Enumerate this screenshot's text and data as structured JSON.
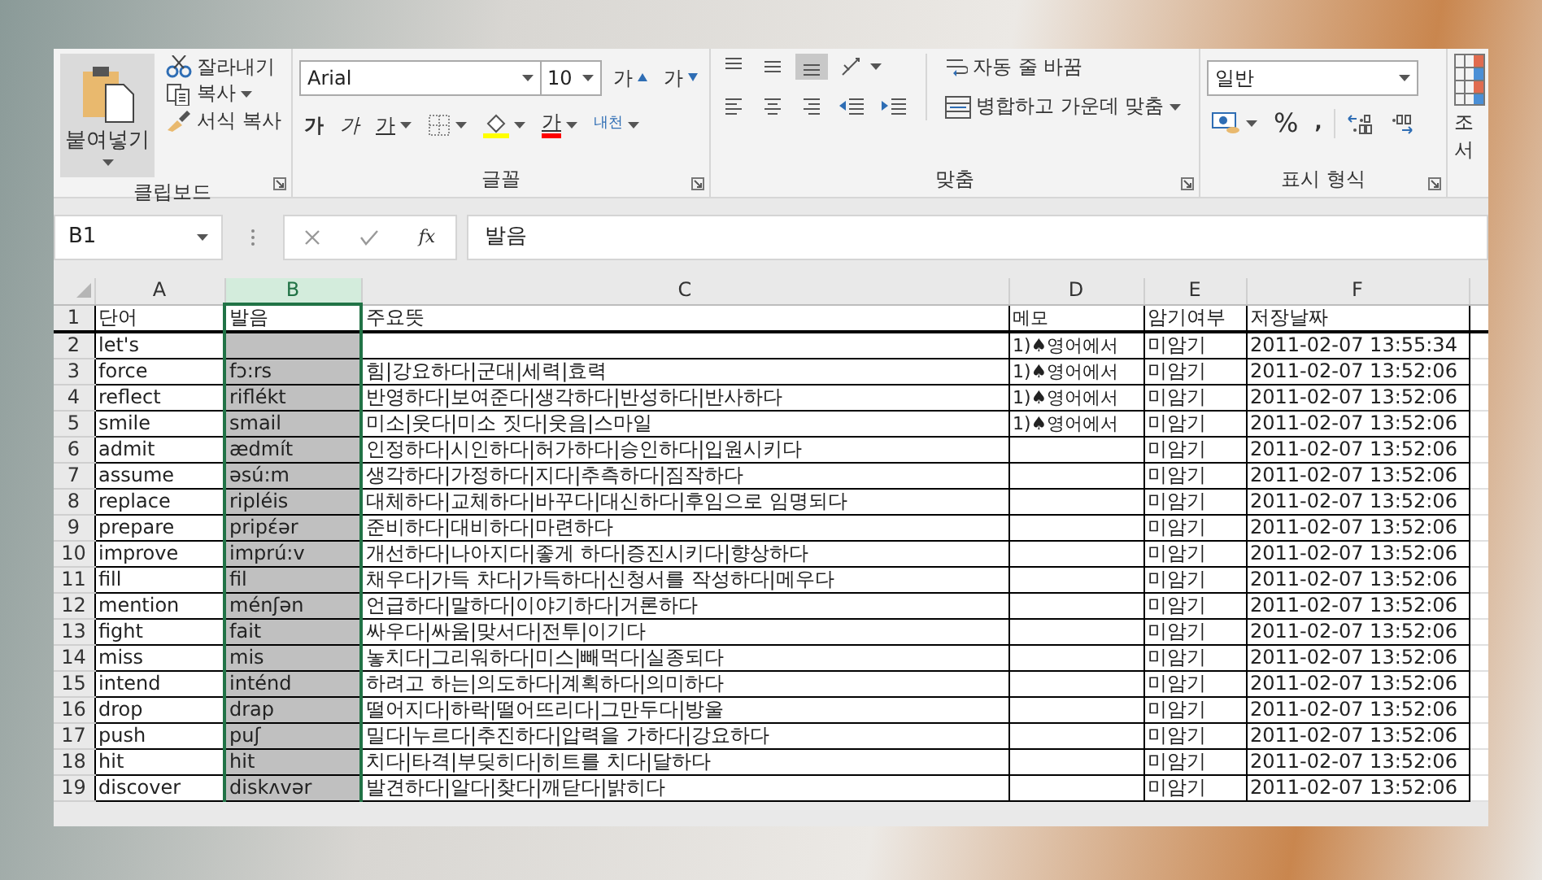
{
  "ribbon": {
    "clipboard": {
      "paste": "붙여넣기",
      "cut": "잘라내기",
      "copy": "복사",
      "format_painter": "서식 복사",
      "label": "클립보드"
    },
    "font": {
      "name": "Arial",
      "size": "10",
      "grow": "가",
      "shrink": "가",
      "styles": [
        {
          "kind": "bold",
          "label": "가"
        },
        {
          "kind": "italic",
          "label": "가"
        },
        {
          "kind": "underline",
          "label": "가"
        }
      ],
      "font_color": "가",
      "phonetic": "내천",
      "label": "글꼴"
    },
    "alignment": {
      "vertical": [
        {
          "kind": "top",
          "selected": false
        },
        {
          "kind": "middle",
          "selected": false
        },
        {
          "kind": "bottom",
          "selected": true
        }
      ],
      "wrap": "자동 줄 바꿈",
      "merge": "병합하고 가운데 맞춤",
      "label": "맞춤"
    },
    "number": {
      "format": "일반",
      "percent": "%",
      "comma": ",",
      "label": "표시 형식"
    },
    "conditional": [
      "조",
      "서"
    ]
  },
  "formula_bar": {
    "name_box": "B1",
    "function": "fx",
    "formula": "발음"
  },
  "sheet": {
    "columns": [
      {
        "label": "A",
        "selected": false
      },
      {
        "label": "B",
        "selected": true
      },
      {
        "label": "C",
        "selected": false
      },
      {
        "label": "D",
        "selected": false
      },
      {
        "label": "E",
        "selected": false
      },
      {
        "label": "F",
        "selected": false
      }
    ],
    "rows": [
      {
        "number": "1",
        "word": "단어",
        "pron": "발음",
        "meaning": "주요뜻",
        "memo": "메모",
        "status": "암기여부",
        "date": "저장날짜"
      },
      {
        "number": "2",
        "word": "let's",
        "memo": "1)♠영어에서",
        "status": "미암기",
        "date": "2011-02-07 13:55:34"
      },
      {
        "number": "3",
        "word": "force",
        "pron": "fɔ:rs",
        "meaning": "힘|강요하다|군대|세력|효력",
        "memo": "1)♠영어에서",
        "status": "미암기",
        "date": "2011-02-07 13:52:06"
      },
      {
        "number": "4",
        "word": "reflect",
        "pron": "riflékt",
        "meaning": "반영하다|보여준다|생각하다|반성하다|반사하다",
        "memo": "1)♠영어에서",
        "status": "미암기",
        "date": "2011-02-07 13:52:06"
      },
      {
        "number": "5",
        "word": "smile",
        "pron": "smail",
        "meaning": "미소|웃다|미소 짓다|웃음|스마일",
        "memo": "1)♠영어에서",
        "status": "미암기",
        "date": "2011-02-07 13:52:06"
      },
      {
        "number": "6",
        "word": "admit",
        "pron": "ædmít",
        "meaning": "인정하다|시인하다|허가하다|승인하다|입원시키다",
        "status": "미암기",
        "date": "2011-02-07 13:52:06"
      },
      {
        "number": "7",
        "word": "assume",
        "pron": "əsú:m",
        "meaning": "생각하다|가정하다|지다|추측하다|짐작하다",
        "status": "미암기",
        "date": "2011-02-07 13:52:06"
      },
      {
        "number": "8",
        "word": "replace",
        "pron": "ripléis",
        "meaning": "대체하다|교체하다|바꾸다|대신하다|후임으로 임명되다",
        "status": "미암기",
        "date": "2011-02-07 13:52:06"
      },
      {
        "number": "9",
        "word": "prepare",
        "pron": "pripέər",
        "meaning": "준비하다|대비하다|마련하다",
        "status": "미암기",
        "date": "2011-02-07 13:52:06"
      },
      {
        "number": "10",
        "word": "improve",
        "pron": "imprú:v",
        "meaning": "개선하다|나아지다|좋게 하다|증진시키다|향상하다",
        "status": "미암기",
        "date": "2011-02-07 13:52:06"
      },
      {
        "number": "11",
        "word": "fill",
        "pron": "fil",
        "meaning": "채우다|가득 차다|가득하다|신청서를 작성하다|메우다",
        "status": "미암기",
        "date": "2011-02-07 13:52:06"
      },
      {
        "number": "12",
        "word": "mention",
        "pron": "ménʃən",
        "meaning": "언급하다|말하다|이야기하다|거론하다",
        "status": "미암기",
        "date": "2011-02-07 13:52:06"
      },
      {
        "number": "13",
        "word": "fight",
        "pron": "fait",
        "meaning": "싸우다|싸움|맞서다|전투|이기다",
        "status": "미암기",
        "date": "2011-02-07 13:52:06"
      },
      {
        "number": "14",
        "word": "miss",
        "pron": "mis",
        "meaning": "놓치다|그리워하다|미스|빼먹다|실종되다",
        "status": "미암기",
        "date": "2011-02-07 13:52:06"
      },
      {
        "number": "15",
        "word": "intend",
        "pron": "inténd",
        "meaning": "하려고 하는|의도하다|계획하다|의미하다",
        "status": "미암기",
        "date": "2011-02-07 13:52:06"
      },
      {
        "number": "16",
        "word": "drop",
        "pron": "drap",
        "meaning": "떨어지다|하락|떨어뜨리다|그만두다|방울",
        "status": "미암기",
        "date": "2011-02-07 13:52:06"
      },
      {
        "number": "17",
        "word": "push",
        "pron": "puʃ",
        "meaning": "밀다|누르다|추진하다|압력을 가하다|강요하다",
        "status": "미암기",
        "date": "2011-02-07 13:52:06"
      },
      {
        "number": "18",
        "word": "hit",
        "pron": "hit",
        "meaning": "치다|타격|부딪히다|히트를 치다|달하다",
        "status": "미암기",
        "date": "2011-02-07 13:52:06"
      },
      {
        "number": "19",
        "word": "discover",
        "pron": "diskʌvər",
        "meaning": "발견하다|알다|찾다|깨닫다|밝히다",
        "status": "미암기",
        "date": "2011-02-07 13:52:06"
      }
    ]
  }
}
